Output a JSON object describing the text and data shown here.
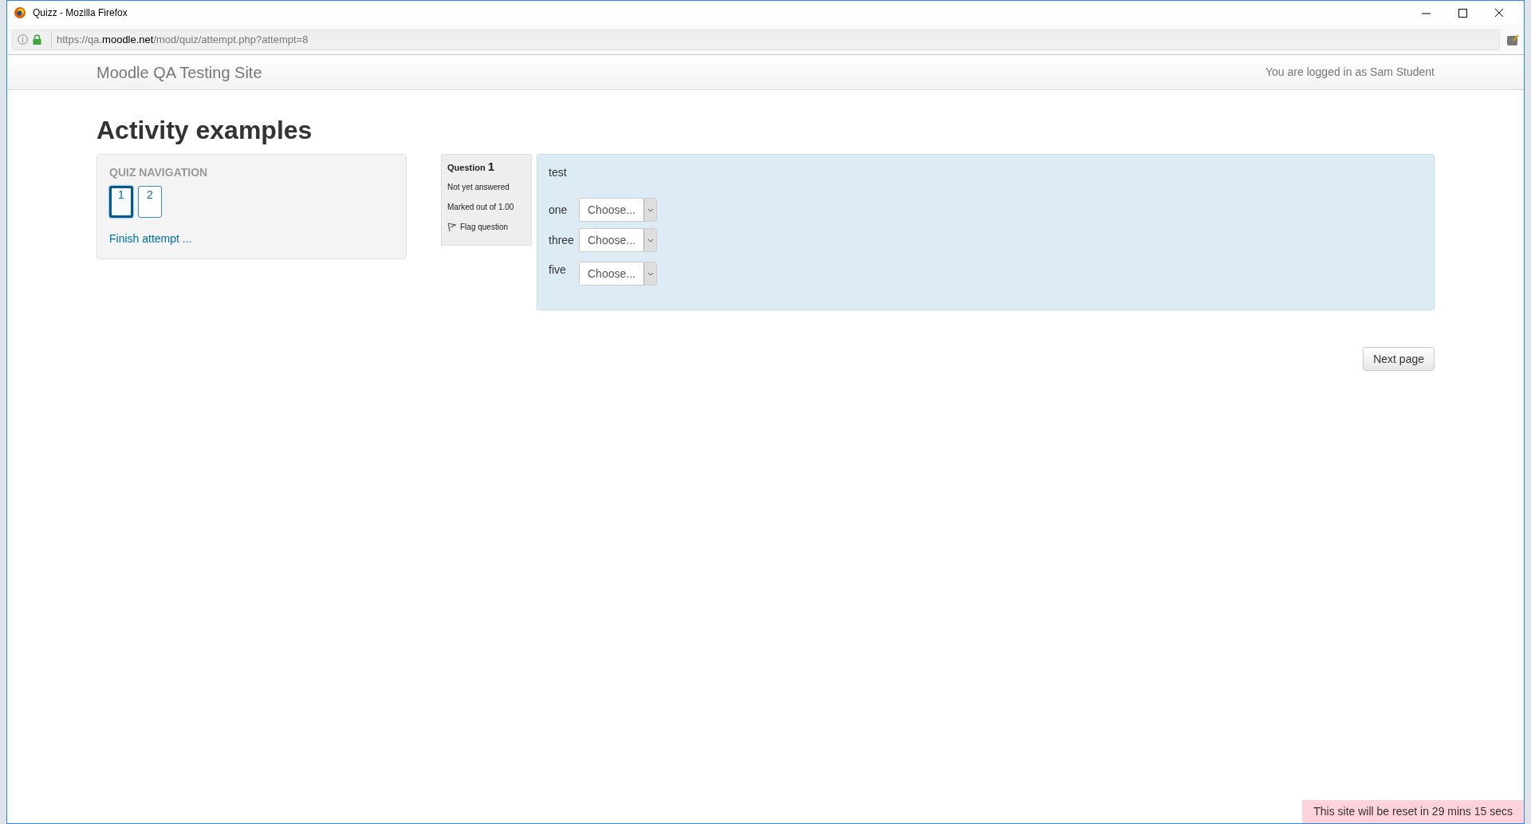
{
  "window": {
    "title": "Quizz - Mozilla Firefox"
  },
  "address_bar": {
    "url_prefix": "https://qa.",
    "url_domain": "moodle.net",
    "url_path": "/mod/quiz/attempt.php?attempt=8"
  },
  "header": {
    "site_name": "Moodle QA Testing Site",
    "login_info": "You are logged in as Sam Student"
  },
  "page_title": "Activity examples",
  "quiz_navigation": {
    "title": "QUIZ NAVIGATION",
    "questions": [
      {
        "label": "1",
        "selected": true
      },
      {
        "label": "2",
        "selected": false
      }
    ],
    "finish_link": "Finish attempt ..."
  },
  "question_info": {
    "label": "Question",
    "number": "1",
    "status": "Not yet answered",
    "marks": "Marked out of 1.00",
    "flag_label": "Flag question"
  },
  "question": {
    "text": "test",
    "items": [
      {
        "label": "one",
        "value": "Choose..."
      },
      {
        "label": "three",
        "value": "Choose..."
      },
      {
        "label": "five",
        "value": "Choose..."
      }
    ]
  },
  "next_button": "Next page",
  "reset_notice": "This site will be reset in 29 mins 15 secs"
}
